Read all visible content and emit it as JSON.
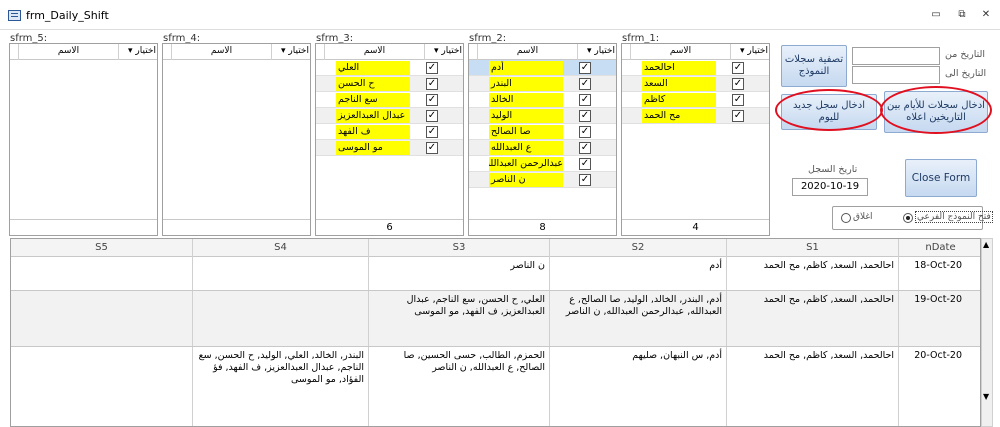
{
  "window": {
    "title": "frm_Daily_Shift"
  },
  "subforms": [
    {
      "label": "sfrm_5:",
      "header": {
        "pick": "اختيار",
        "name": "الاسم"
      },
      "rows": [],
      "count": ""
    },
    {
      "label": "sfrm_4:",
      "header": {
        "pick": "اختيار",
        "name": "الاسم"
      },
      "rows": [],
      "count": ""
    },
    {
      "label": "sfrm_3:",
      "header": {
        "pick": "اختيار",
        "name": "الاسم"
      },
      "rows": [
        "العلي",
        "ح الحسن",
        "سع الناجم",
        "عبدال العبدالعزيز",
        "ف الفهد",
        "مو الموسى"
      ],
      "count": "6"
    },
    {
      "label": "sfrm_2:",
      "header": {
        "pick": "اختيار",
        "name": "الاسم"
      },
      "rows": [
        "أدم",
        "البندر",
        "الخالد",
        "الوليد",
        "صا الصالح",
        "ع العبدالله",
        "عبدالرحمن العبدالله",
        "ن الناصر"
      ],
      "count": "8"
    },
    {
      "label": "sfrm_1:",
      "header": {
        "pick": "اختيار",
        "name": "الاسم"
      },
      "rows": [
        "احالحمد",
        "السعد",
        "كاظم",
        "مح الحمد"
      ],
      "count": "4"
    }
  ],
  "controls": {
    "date_from_label": "التاريخ من",
    "date_to_label": "التاريخ الى",
    "clear_btn": "تصفية سجلات النموذج",
    "insert_range_btn": "ادخال سجلات للأيام بين التاريخين اعلاه",
    "insert_today_btn": "ادخال سجل جديد لليوم",
    "record_date_label": "تاريخ السجل",
    "record_date_value": "2020-10-19",
    "close_btn": "Close Form",
    "radio_open": "فتح النموذج الفرعي",
    "radio_close": "اغلاق"
  },
  "grid": {
    "columns": [
      "S5",
      "S4",
      "S3",
      "S2",
      "S1",
      "nDate"
    ],
    "rows": [
      {
        "nDate": "18-Oct-20",
        "S1": "احالحمد, السعد, كاظم, مح الحمد",
        "S2": "أدم",
        "S3": "ن الناصر",
        "S4": "",
        "S5": ""
      },
      {
        "nDate": "19-Oct-20",
        "S1": "احالحمد, السعد, كاظم, مح الحمد",
        "S2": "أدم, البندر, الخالد, الوليد, صا الصالح, ع العبدالله, عبدالرحمن العبدالله, ن الناصر",
        "S3": "العلي, ح الحسن, سع الناجم, عبدال العبدالعزيز, ف الفهد, مو الموسى",
        "S4": "",
        "S5": ""
      },
      {
        "nDate": "20-Oct-20",
        "S1": "احالحمد, السعد, كاظم, مح الحمد",
        "S2": "أدم, س النبهان, صليهم",
        "S3": "الحمزم, الطالب, حسى الحسين, صا الصالح, ع العبدالله, ن الناصر",
        "S4": "البندر, الخالد, العلي, الوليد, ح الحسن, سع الناجم, عبدال العبدالعزيز, ف الفهد, فؤ الفؤاد, مو الموسى",
        "S5": ""
      }
    ]
  }
}
